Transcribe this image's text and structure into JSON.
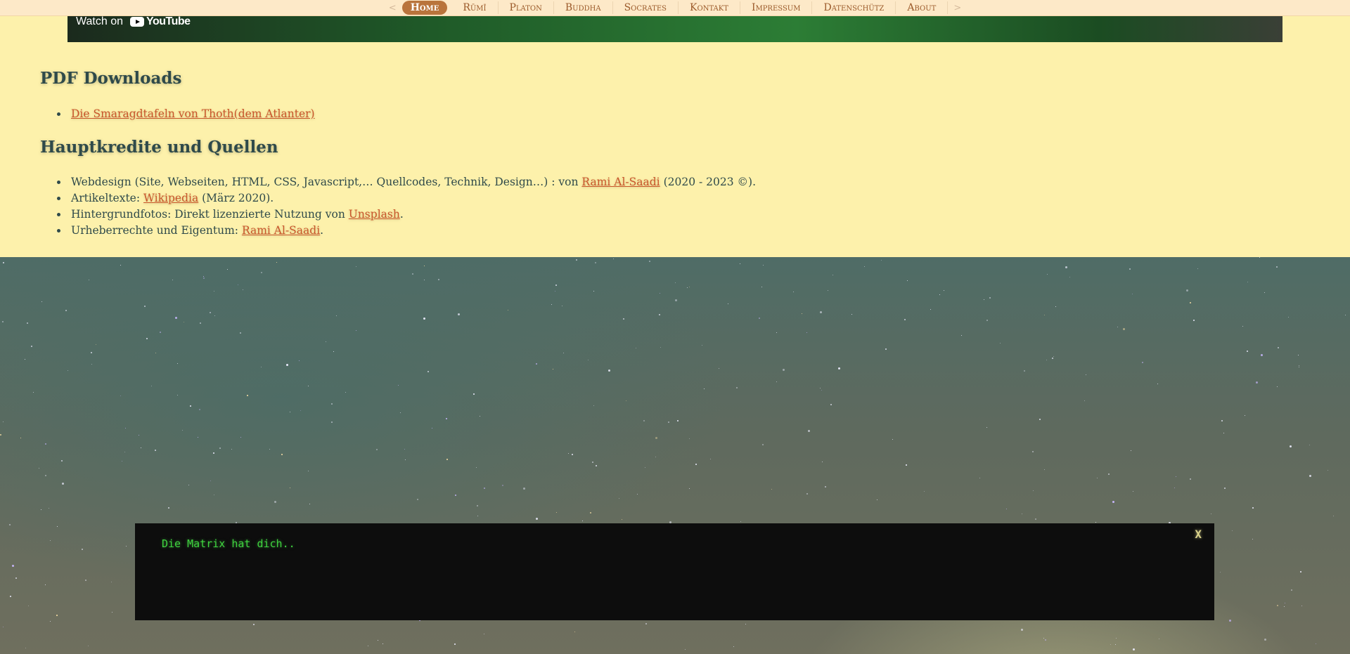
{
  "nav": {
    "prev_arrow": "<",
    "next_arrow": ">",
    "items": [
      {
        "label": "Home"
      },
      {
        "label": "Rūmī"
      },
      {
        "label": "Platon"
      },
      {
        "label": "Buddha"
      },
      {
        "label": "Socrates"
      },
      {
        "label": "Kontakt"
      },
      {
        "label": "Impressum"
      },
      {
        "label": "Datenschütz"
      },
      {
        "label": "About"
      }
    ]
  },
  "video": {
    "watch_label": "Watch on",
    "logo_text": "YouTube"
  },
  "pdf": {
    "heading": "PDF Downloads",
    "links": [
      {
        "label": "Die Smaragdtafeln von Thoth(dem Atlanter)"
      }
    ]
  },
  "credits": {
    "heading": "Hauptkredite und Quellen",
    "items": [
      {
        "prefix": "Webdesign (Site, Webseiten, HTML, CSS, Javascript,… Quellcodes, Technik, Design…) : von ",
        "link": "Rami Al-Saadi",
        "suffix": " (2020 - 2023 ©)."
      },
      {
        "prefix": "Artikeltexte: ",
        "link": "Wikipedia",
        "suffix": " (März 2020)."
      },
      {
        "prefix": "Hintergrundfotos: Direkt lizenzierte Nutzung von ",
        "link": "Unsplash",
        "suffix": "."
      },
      {
        "prefix": "Urheberrechte und Eigentum: ",
        "link": "Rami Al-Saadi",
        "suffix": "."
      }
    ]
  },
  "matrix": {
    "message": "Die Matrix hat dich..",
    "close_label": "X"
  }
}
